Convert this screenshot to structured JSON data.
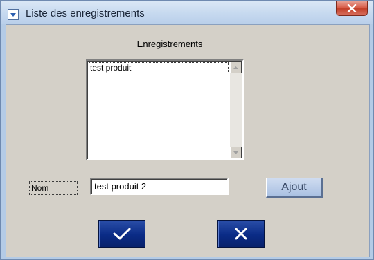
{
  "window": {
    "title": "Liste des enregistrements",
    "title_icon": "app-window-icon",
    "close_icon": "close-icon"
  },
  "section": {
    "label": "Enregistrements"
  },
  "records": {
    "items": [
      "test produit"
    ],
    "scroll_icons": [
      "arrow-up-icon",
      "arrow-down-icon"
    ]
  },
  "form": {
    "name_label": "Nom",
    "name_value": "test produit 2",
    "add_label": "Ajout"
  },
  "actions": {
    "ok_icon": "checkmark-icon",
    "cancel_icon": "x-icon"
  },
  "colors": {
    "dialog_bg": "#d4d0c8",
    "action_button_blue": "#0a2b86",
    "add_button_blue": "#a9c0e2",
    "close_button_red": "#c23f28"
  }
}
